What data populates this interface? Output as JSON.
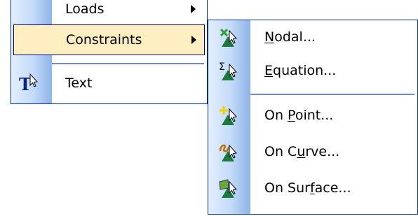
{
  "parent_menu": {
    "items": [
      {
        "label": "Loads",
        "has_submenu": true
      },
      {
        "label": "Constraints",
        "has_submenu": true,
        "highlighted": true
      },
      {
        "label": "Text",
        "icon": "text-insert-icon"
      }
    ]
  },
  "constraints_submenu": {
    "items": [
      {
        "pre": "",
        "mnemonic": "N",
        "post": "odal...",
        "icon": "nodal-constraint-icon"
      },
      {
        "pre": "",
        "mnemonic": "E",
        "post": "quation...",
        "icon": "equation-constraint-icon"
      },
      {
        "pre": "On ",
        "mnemonic": "P",
        "post": "oint...",
        "icon": "point-constraint-icon"
      },
      {
        "pre": "On C",
        "mnemonic": "u",
        "post": "rve...",
        "icon": "curve-constraint-icon"
      },
      {
        "pre": "On Sur",
        "mnemonic": "f",
        "post": "ace...",
        "icon": "surface-constraint-icon"
      }
    ]
  },
  "colors": {
    "menu_border": "#002d96",
    "highlight_fill": "#ffeec2",
    "highlight_border": "#000080",
    "gutter_light": "#e3efff",
    "gutter_dark": "#8eb3e7"
  }
}
